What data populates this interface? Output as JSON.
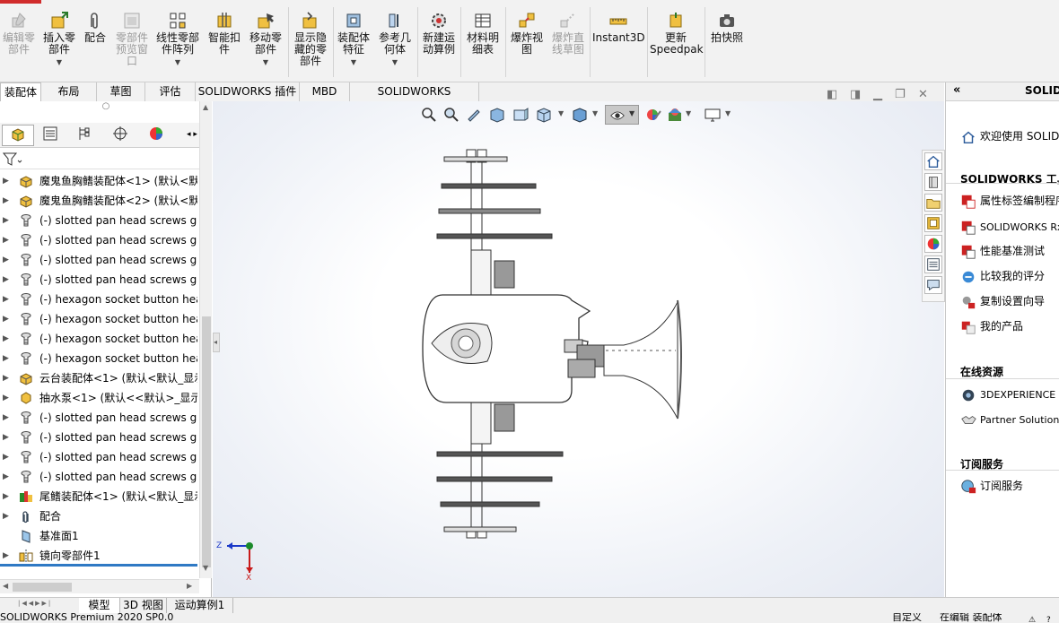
{
  "ribbon": {
    "buttons": [
      {
        "label": "编辑零\n部件",
        "disabled": true
      },
      {
        "label": "插入零\n部件",
        "disabled": false,
        "dropdown": true
      },
      {
        "label": "配合",
        "disabled": false
      },
      {
        "label": "零部件\n预览窗\n口",
        "disabled": true
      },
      {
        "label": "线性零部\n件阵列",
        "disabled": false,
        "dropdown": true
      },
      {
        "label": "智能扣\n件",
        "disabled": false
      },
      {
        "label": "移动零\n部件",
        "disabled": false,
        "dropdown": true
      },
      {
        "label": "显示隐\n藏的零\n部件",
        "disabled": false
      },
      {
        "label": "装配体\n特征",
        "disabled": false,
        "dropdown": true
      },
      {
        "label": "参考几\n何体",
        "disabled": false,
        "dropdown": true
      },
      {
        "label": "新建运\n动算例",
        "disabled": false
      },
      {
        "label": "材料明\n细表",
        "disabled": false
      },
      {
        "label": "爆炸视\n图",
        "disabled": false
      },
      {
        "label": "爆炸直\n线草图",
        "disabled": true
      },
      {
        "label": "Instant3D",
        "disabled": false
      },
      {
        "label": "更新\nSpeedpak",
        "disabled": false
      },
      {
        "label": "拍快照",
        "disabled": false
      }
    ]
  },
  "command_tabs": [
    "装配体",
    "布局",
    "草图",
    "评估",
    "SOLIDWORKS 插件",
    "MBD",
    "SOLIDWORKS Inspection"
  ],
  "feature_tree": {
    "items": [
      {
        "text": "魔鬼鱼胸鳍装配体<1> (默认<默认",
        "icon": "assembly-icon"
      },
      {
        "text": "魔鬼鱼胸鳍装配体<2> (默认<默",
        "icon": "assembly-icon"
      },
      {
        "text": "(-) slotted pan head screws gb",
        "icon": "screw-icon"
      },
      {
        "text": "(-) slotted pan head screws gb",
        "icon": "screw-icon"
      },
      {
        "text": "(-) slotted pan head screws gb",
        "icon": "screw-icon"
      },
      {
        "text": "(-) slotted pan head screws gb",
        "icon": "screw-icon"
      },
      {
        "text": "(-) hexagon socket button hea",
        "icon": "screw-icon"
      },
      {
        "text": "(-) hexagon socket button hea",
        "icon": "screw-icon"
      },
      {
        "text": "(-) hexagon socket button hea",
        "icon": "screw-icon"
      },
      {
        "text": "(-) hexagon socket button hea",
        "icon": "screw-icon"
      },
      {
        "text": "云台装配体<1> (默认<默认_显示",
        "icon": "assembly-icon"
      },
      {
        "text": "抽水泵<1> (默认<<默认>_显示",
        "icon": "part-icon"
      },
      {
        "text": "(-) slotted pan head screws gb",
        "icon": "screw-icon"
      },
      {
        "text": "(-) slotted pan head screws gb",
        "icon": "screw-icon"
      },
      {
        "text": "(-) slotted pan head screws gb",
        "icon": "screw-icon"
      },
      {
        "text": "(-) slotted pan head screws gb",
        "icon": "screw-icon"
      },
      {
        "text": "尾鳍装配体<1> (默认<默认_显示",
        "icon": "assembly-color-icon"
      },
      {
        "text": "配合",
        "icon": "mates-icon"
      },
      {
        "text": "基准面1",
        "icon": "plane-icon",
        "no_arrow": true
      },
      {
        "text": "镜向零部件1",
        "icon": "mirror-icon"
      }
    ]
  },
  "axis": {
    "z": "Z",
    "x": "X"
  },
  "task_pane": {
    "header": "SOLID",
    "welcome": "欢迎使用 SOLIDW",
    "sections": [
      {
        "title": "SOLIDWORKS 工具",
        "items": [
          "属性标签编制程序",
          "SOLIDWORKS Rx",
          "性能基准测试",
          "比较我的评分",
          "复制设置向导",
          "我的产品"
        ]
      },
      {
        "title": "在线资源",
        "items": [
          "3DEXPERIENCE M",
          "Partner Solutions"
        ]
      },
      {
        "title": "订阅服务",
        "items": [
          "订阅服务"
        ]
      }
    ]
  },
  "bottom_tabs": [
    "模型",
    "3D 视图",
    "运动算例1"
  ],
  "status": {
    "left": "SOLIDWORKS Premium 2020 SP0.0",
    "custom": "自定义",
    "editing": "在编辑 装配体"
  },
  "colors": {
    "accent": "#2f79c4",
    "red": "#d12c2c"
  }
}
